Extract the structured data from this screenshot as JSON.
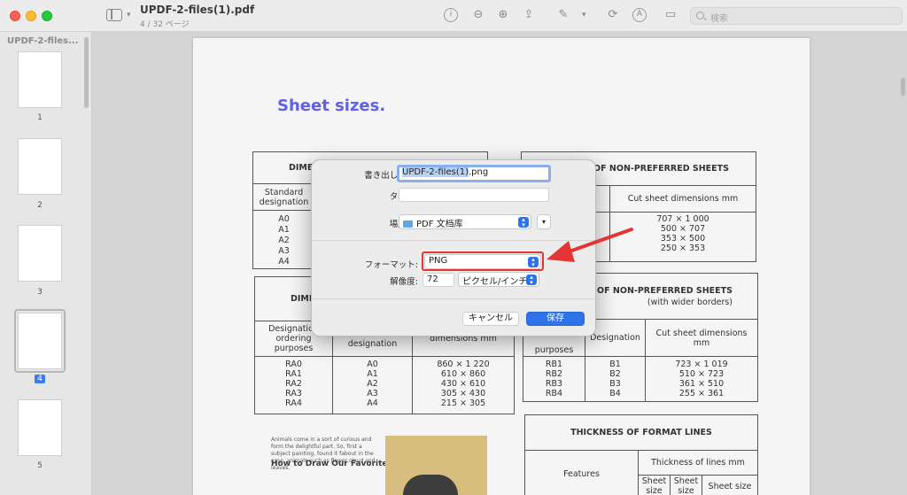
{
  "window": {
    "title": "UPDF-2-files(1).pdf",
    "pages": "4 / 32 ページ"
  },
  "toolbar": {
    "search_placeholder": "検索"
  },
  "sidebar": {
    "title": "UPDF-2-files...",
    "thumbnails": [
      {
        "label": "1"
      },
      {
        "label": "2"
      },
      {
        "label": "3"
      },
      {
        "label": "4"
      },
      {
        "label": "5"
      }
    ],
    "active": "4"
  },
  "document": {
    "heading": "Sheet sizes.",
    "table1": {
      "title": "DIME",
      "col1": "Standard designation",
      "rows": [
        "A0",
        "A1",
        "A2",
        "A3",
        "A4"
      ]
    },
    "table2": {
      "title": "S OF NON-PREFERRED SHEETS",
      "col2": "Cut sheet dimensions mm",
      "rows": [
        "707 × 1 000",
        "500 × 707",
        "353 × 500",
        "250 × 353"
      ]
    },
    "table3": {
      "title": "DIME",
      "col1": "Designation ordering purposes",
      "col2": "Standard designation",
      "col3": "dimensions mm",
      "rows": [
        [
          "RA0",
          "A0",
          "860 × 1 220"
        ],
        [
          "RA1",
          "A1",
          "610 × 860"
        ],
        [
          "RA2",
          "A2",
          "430 × 610"
        ],
        [
          "RA3",
          "A3",
          "305 × 430"
        ],
        [
          "RA4",
          "A4",
          "215 × 305"
        ]
      ]
    },
    "table4": {
      "title": "S OF NON-PREFERRED SHEETS",
      "subtitle": "(with wider borders)",
      "col1": "purposes",
      "col2": "Designation",
      "col3": "Cut sheet dimensions mm",
      "rows": [
        [
          "RB1",
          "B1",
          "723 × 1 019"
        ],
        [
          "RB2",
          "B2",
          "510 × 723"
        ],
        [
          "RB3",
          "B3",
          "361 × 510"
        ],
        [
          "RB4",
          "B4",
          "255 × 361"
        ]
      ]
    },
    "table5": {
      "title": "THICKNESS OF FORMAT LINES",
      "col1": "Features",
      "col2": "Thickness of lines mm",
      "sub": [
        "Sheet size",
        "Sheet size",
        "Sheet size"
      ]
    },
    "article": {
      "title": "How to Draw Our Favorite Pets",
      "body": "Animals come in a sort of curious and form the delightful part. So, first a subject painting, found it fabout in the case, animals such as flower cloud and leaves."
    }
  },
  "dialog": {
    "export_name_label": "書き出し名:",
    "filename_selected": "UPDF-2-files(1)",
    "filename_ext": ".png",
    "tags_label": "タグ:",
    "location_label": "場所:",
    "location_value": "PDF 文档库",
    "format_label": "フォーマット:",
    "format_value": "PNG",
    "resolution_label": "解像度:",
    "resolution_value": "72",
    "resolution_unit": "ピクセル/インチ",
    "cancel_label": "キャンセル",
    "save_label": "保存"
  },
  "colors": {
    "accent": "#2f73e8",
    "highlight": "#e53434",
    "heading": "#6060e8"
  }
}
